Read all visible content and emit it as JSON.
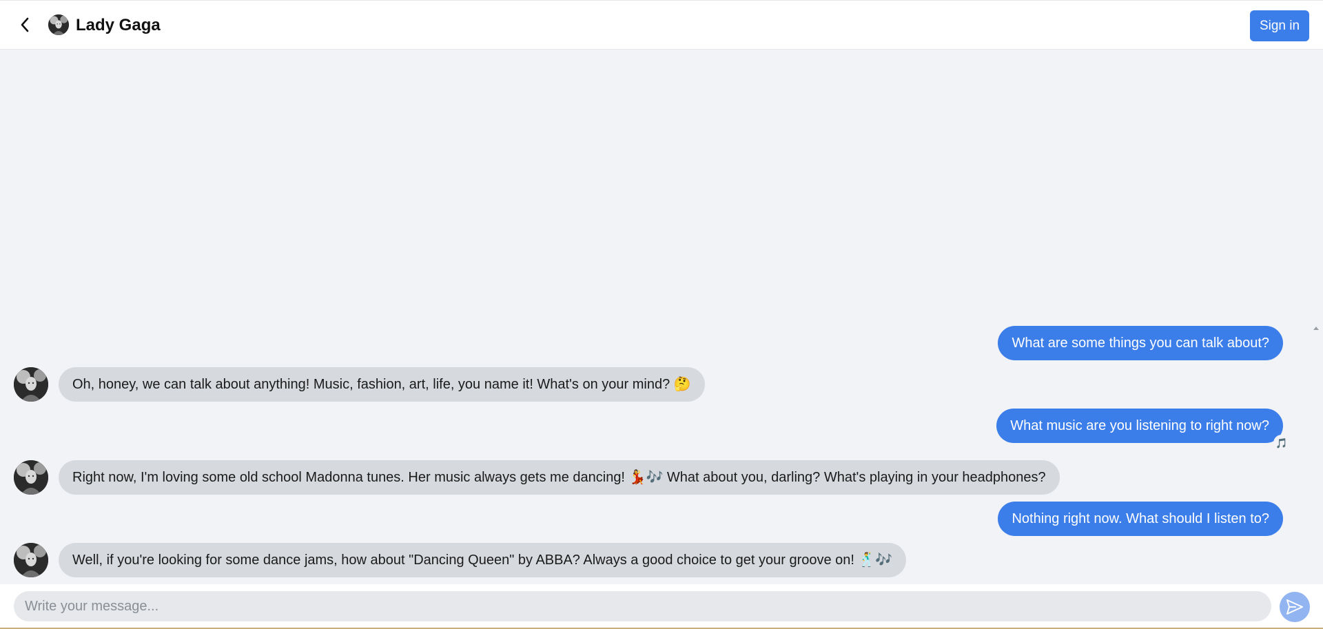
{
  "header": {
    "title": "Lady Gaga",
    "signin_label": "Sign in"
  },
  "messages": [
    {
      "role": "user",
      "text": "What are some things you can talk about?"
    },
    {
      "role": "bot",
      "text": "Oh, honey, we can talk about anything! Music, fashion, art, life, you name it! What's on your mind? 🤔"
    },
    {
      "role": "user",
      "text": "What music are you listening to right now?",
      "reaction": "🎵"
    },
    {
      "role": "bot",
      "text": "Right now, I'm loving some old school Madonna tunes. Her music always gets me dancing! 💃🎶 What about you, darling? What's playing in your headphones?"
    },
    {
      "role": "user",
      "text": "Nothing right now. What should I listen to?"
    },
    {
      "role": "bot",
      "text": "Well, if you're looking for some dance jams, how about \"Dancing Queen\" by ABBA? Always a good choice to get your groove on! 🕺🎶"
    }
  ],
  "composer": {
    "placeholder": "Write your message..."
  },
  "colors": {
    "accent": "#3b7de9",
    "bot_bubble": "#d6d9de",
    "background": "#f2f3f6",
    "send_button": "#92b4f0"
  },
  "icons": {
    "back": "chevron-left-icon",
    "send": "send-icon",
    "reaction": "music-note-icon"
  }
}
